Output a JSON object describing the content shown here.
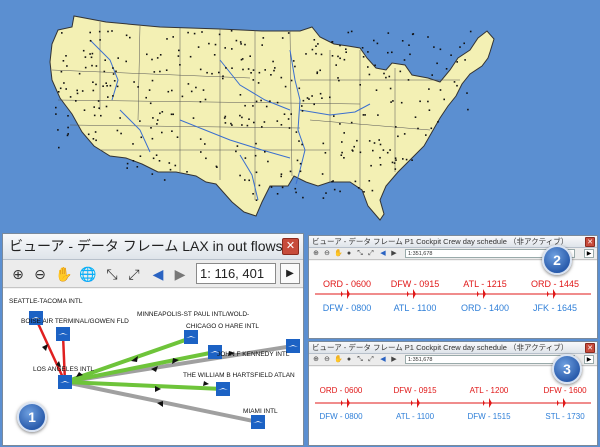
{
  "panel1": {
    "title": "ビューア - データ フレーム LAX in out flows ...",
    "scale": "1: 116, 401",
    "labels": {
      "seattle": "SEATTLE-TACOMA INTL",
      "boise": "BOISE AIR TERMINAL/GOWEN FLD",
      "minneapolis": "MINNEAPOLIS-ST PAUL INTL/WOLD-",
      "chicago": "CHICAGO O HARE INTL",
      "jfk": "JOHN F KENNEDY INTL",
      "la": "LOS ANGELES INTL",
      "atlanta": "THE WILLIAM B HARTSFIELD ATLAN",
      "miami": "MIAMI INTL"
    },
    "badge": "1"
  },
  "panel2": {
    "title": "ビューア - データ フレーム P1 Cockpit Crew day schedule （非アクティブ）",
    "scale": "1:351,678",
    "top_labels": [
      "ORD - 0600",
      "DFW - 0915",
      "ATL - 1215",
      "ORD - 1445"
    ],
    "bottom_labels": [
      "DFW - 0800",
      "ATL - 1100",
      "ORD - 1400",
      "JFK - 1645"
    ],
    "badge": "2"
  },
  "panel3": {
    "title": "ビューア - データ フレーム P1 Cockpit Crew day schedule （非アクティブ）",
    "scale": "1:351,678",
    "top_labels": [
      "ORD - 0600",
      "DFW - 0915",
      "ATL - 1200",
      "DFW - 1600"
    ],
    "bottom_labels": [
      "DFW - 0800",
      "ATL - 1100",
      "DFW - 1515",
      "STL - 1730"
    ],
    "badge": "3"
  },
  "icons": {
    "zoom_in": "zoom-in-icon",
    "zoom_out": "zoom-out-icon",
    "pan": "hand-pan-icon",
    "globe": "globe-icon",
    "fixed_zoom_in": "fixed-zoom-in-icon",
    "fixed_zoom_out": "fixed-zoom-out-icon",
    "back": "back-arrow-icon",
    "forward": "forward-arrow-icon",
    "airport": "airport-icon",
    "airplane": "airplane-icon"
  },
  "colors": {
    "sea": "#5b8fd1",
    "land": "#f3f0b4",
    "rivers": "#3b6fcf",
    "flow_green": "#6ec43a",
    "flow_gray": "#a0a0a0",
    "flow_red": "#e02020",
    "schedule_red": "#e01818",
    "schedule_blue": "#2f7fd8",
    "airport_blue": "#1c62c4"
  }
}
